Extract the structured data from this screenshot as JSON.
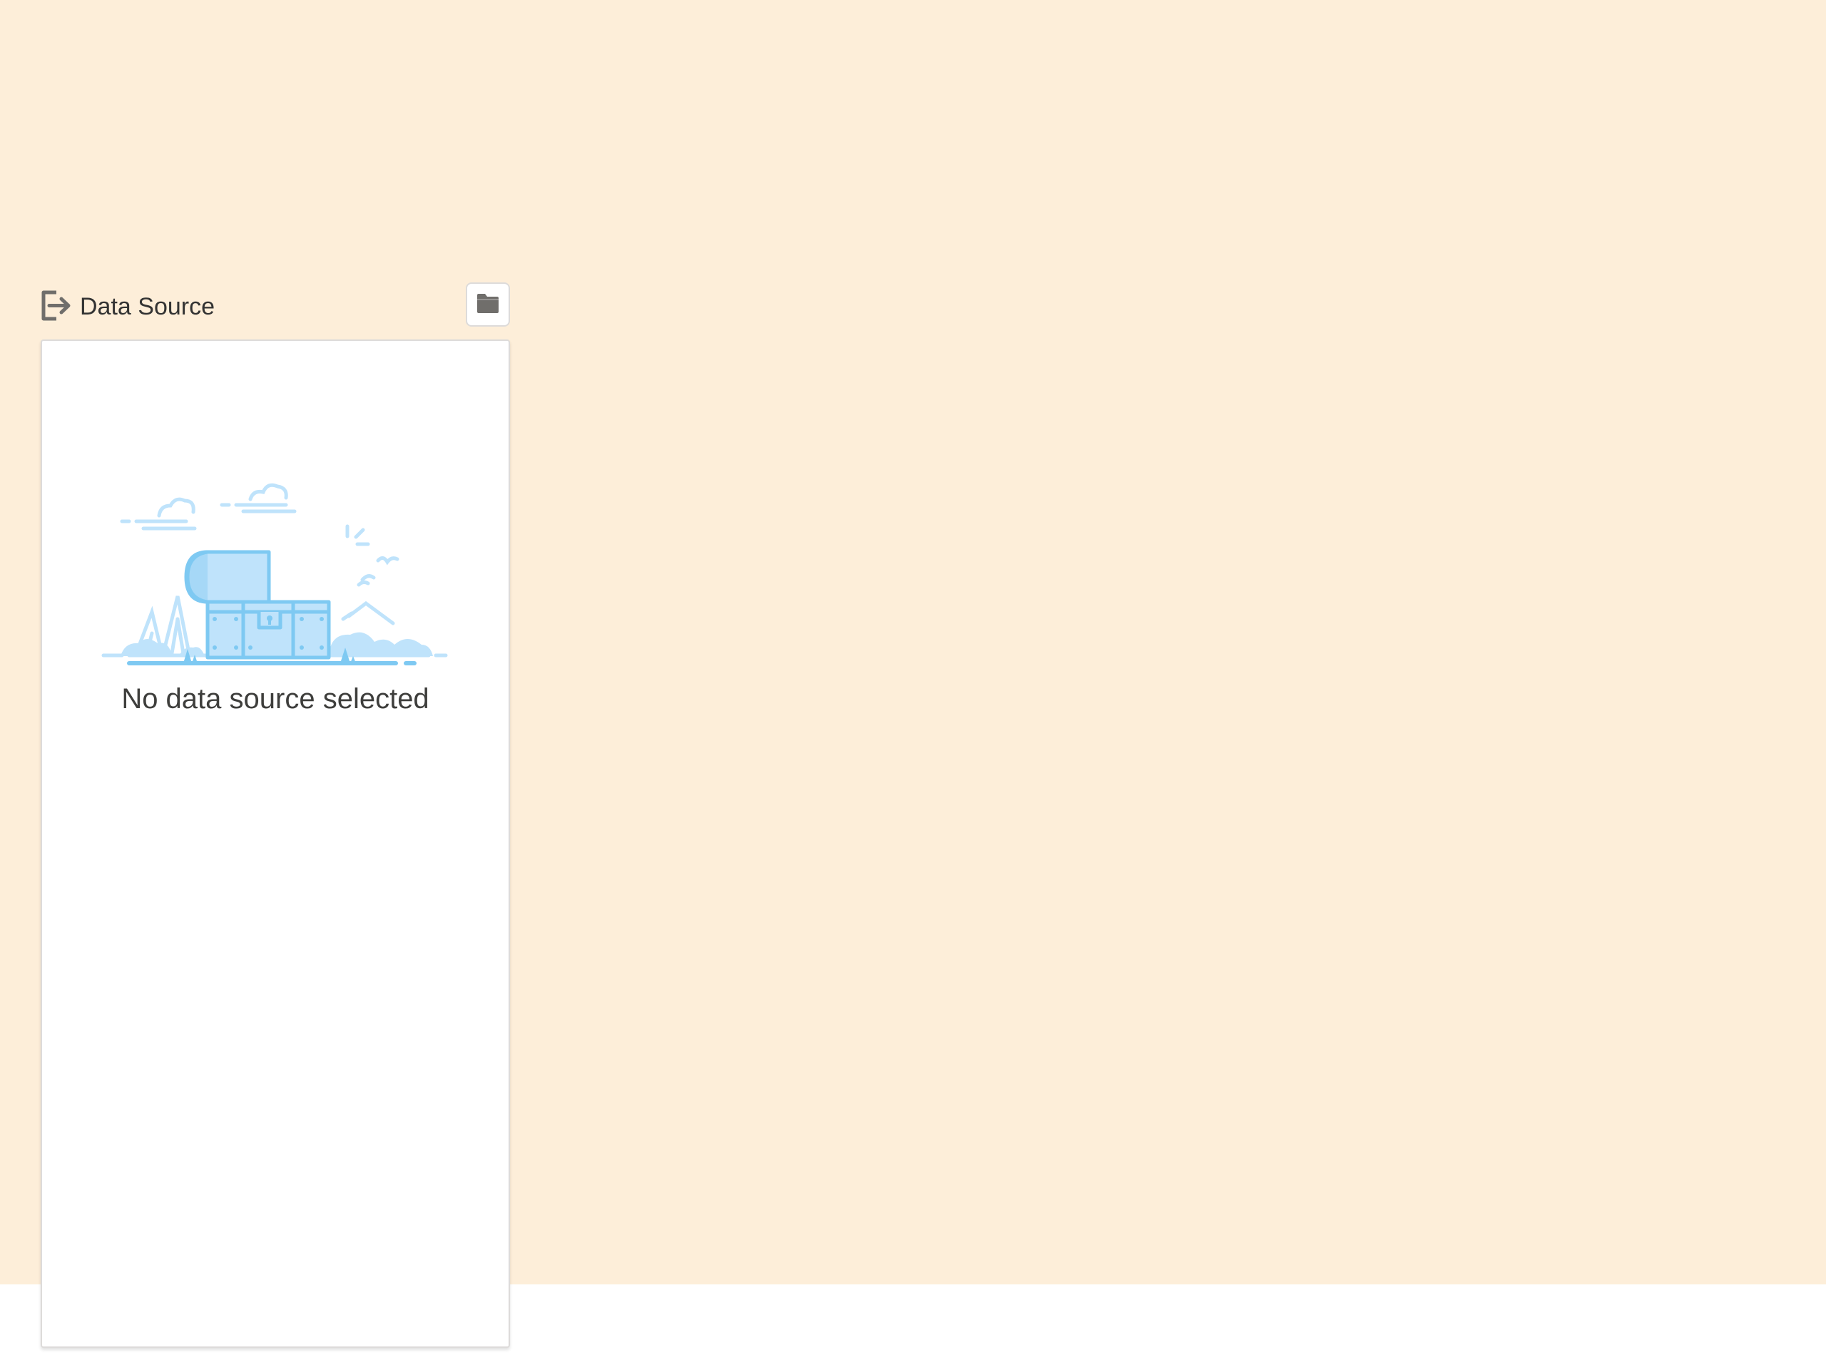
{
  "panel": {
    "title": "Data Source",
    "title_icon": "sign-out-icon",
    "action_icon": "folder-icon"
  },
  "empty_state": {
    "message": "No data source selected",
    "illustration": "treasure-chest-illustration"
  },
  "colors": {
    "page_background": "#fdeed9",
    "card_background": "#ffffff",
    "border": "#dddbda",
    "icon_gray": "#706e6b",
    "illustration_fill": "#bfe3fb",
    "illustration_stroke": "#7ec9f2"
  }
}
